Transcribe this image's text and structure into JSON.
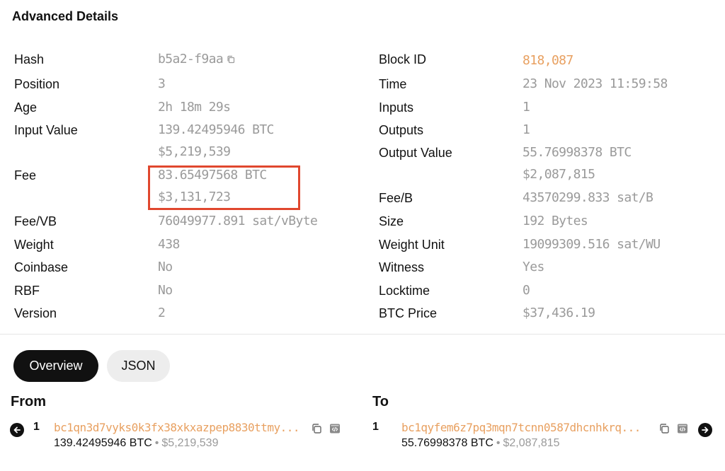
{
  "page": {
    "title": "Advanced Details"
  },
  "details_left": [
    {
      "label": "Hash",
      "value": "b5a2-f9aa"
    },
    {
      "label": "Position",
      "value": "3"
    },
    {
      "label": "Age",
      "value": "2h 18m 29s"
    },
    {
      "label": "Input Value",
      "value": "139.42495946 BTC",
      "value2": "$5,219,539"
    },
    {
      "label": "Fee",
      "value": "83.65497568 BTC",
      "value2": "$3,131,723"
    },
    {
      "label": "Fee/VB",
      "value": "76049977.891 sat/vByte"
    },
    {
      "label": "Weight",
      "value": "438"
    },
    {
      "label": "Coinbase",
      "value": "No"
    },
    {
      "label": "RBF",
      "value": "No"
    },
    {
      "label": "Version",
      "value": "2"
    }
  ],
  "details_right": [
    {
      "label": "Block ID",
      "value": "818,087"
    },
    {
      "label": "Time",
      "value": "23 Nov 2023 11:59:58"
    },
    {
      "label": "Inputs",
      "value": "1"
    },
    {
      "label": "Outputs",
      "value": "1"
    },
    {
      "label": "Output Value",
      "value": "55.76998378 BTC",
      "value2": "$2,087,815"
    },
    {
      "label": "Fee/B",
      "value": "43570299.833 sat/B"
    },
    {
      "label": "Size",
      "value": "192 Bytes"
    },
    {
      "label": "Weight Unit",
      "value": "19099309.516 sat/WU"
    },
    {
      "label": "Witness",
      "value": "Yes"
    },
    {
      "label": "Locktime",
      "value": "0"
    },
    {
      "label": "BTC Price",
      "value": "$37,436.19"
    }
  ],
  "tabs": {
    "overview": "Overview",
    "json": "JSON"
  },
  "from": {
    "heading": "From",
    "index": "1",
    "address": "bc1qn3d7vyks0k3fx38xkxazpep8830ttmy...",
    "amount_btc": "139.42495946 BTC",
    "separator": "•",
    "amount_usd": "$5,219,539"
  },
  "to": {
    "heading": "To",
    "index": "1",
    "address": "bc1qyfem6z7pq3mqn7tcnn0587dhcnhkrq...",
    "amount_btc": "55.76998378 BTC",
    "separator": "•",
    "amount_usd": "$2,087,815"
  },
  "colors": {
    "accent": "#e8a060",
    "highlight": "#e0472e",
    "muted": "#9a9a9a"
  },
  "icons": [
    "copy-icon",
    "code-icon",
    "arrow-left-icon",
    "arrow-right-icon"
  ]
}
